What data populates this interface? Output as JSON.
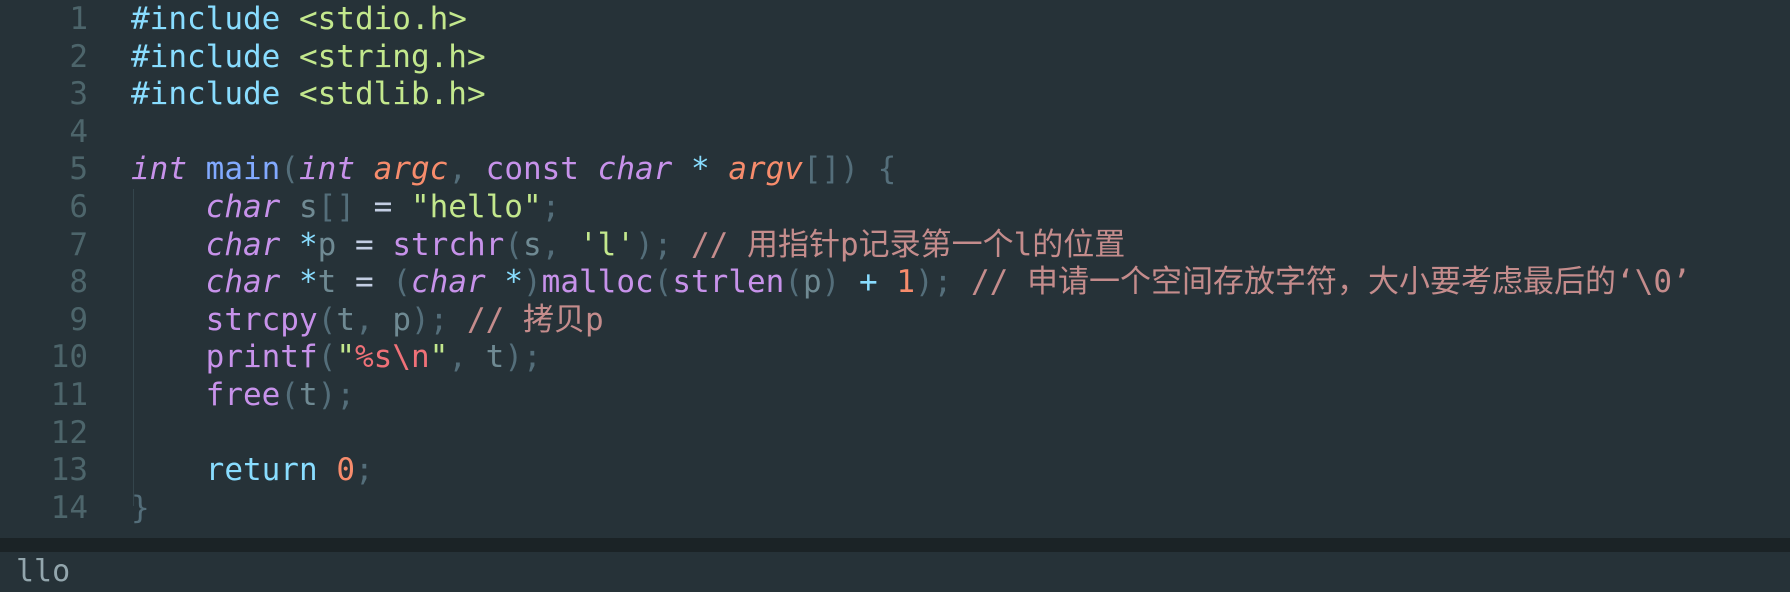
{
  "editor": {
    "line_numbers": [
      "1",
      "2",
      "3",
      "4",
      "5",
      "6",
      "7",
      "8",
      "9",
      "10",
      "11",
      "12",
      "13",
      "14"
    ],
    "lines": [
      [
        {
          "t": "#include",
          "c": "kw"
        },
        {
          "t": " ",
          "c": "plain"
        },
        {
          "t": "<stdio.h>",
          "c": "hdr"
        }
      ],
      [
        {
          "t": "#include",
          "c": "kw"
        },
        {
          "t": " ",
          "c": "plain"
        },
        {
          "t": "<string.h>",
          "c": "hdr"
        }
      ],
      [
        {
          "t": "#include",
          "c": "kw"
        },
        {
          "t": " ",
          "c": "plain"
        },
        {
          "t": "<stdlib.h>",
          "c": "hdr"
        }
      ],
      [],
      [
        {
          "t": "int",
          "c": "typ"
        },
        {
          "t": " ",
          "c": "plain"
        },
        {
          "t": "main",
          "c": "fn"
        },
        {
          "t": "(",
          "c": "pun"
        },
        {
          "t": "int",
          "c": "typ"
        },
        {
          "t": " ",
          "c": "plain"
        },
        {
          "t": "argc",
          "c": "par"
        },
        {
          "t": ", ",
          "c": "pun"
        },
        {
          "t": "const",
          "c": "lib"
        },
        {
          "t": " ",
          "c": "plain"
        },
        {
          "t": "char",
          "c": "typ"
        },
        {
          "t": " ",
          "c": "plain"
        },
        {
          "t": "*",
          "c": "op"
        },
        {
          "t": " ",
          "c": "plain"
        },
        {
          "t": "argv",
          "c": "par"
        },
        {
          "t": "[]) {",
          "c": "pun"
        }
      ],
      [
        {
          "t": "    ",
          "c": "plain"
        },
        {
          "t": "char",
          "c": "typ"
        },
        {
          "t": " ",
          "c": "plain"
        },
        {
          "t": "s",
          "c": "var"
        },
        {
          "t": "[]",
          "c": "pun"
        },
        {
          "t": " = ",
          "c": "plain"
        },
        {
          "t": "\"hello\"",
          "c": "str"
        },
        {
          "t": ";",
          "c": "pun"
        }
      ],
      [
        {
          "t": "    ",
          "c": "plain"
        },
        {
          "t": "char",
          "c": "typ"
        },
        {
          "t": " ",
          "c": "plain"
        },
        {
          "t": "*",
          "c": "op"
        },
        {
          "t": "p",
          "c": "var"
        },
        {
          "t": " = ",
          "c": "plain"
        },
        {
          "t": "strchr",
          "c": "fnp"
        },
        {
          "t": "(",
          "c": "pun"
        },
        {
          "t": "s",
          "c": "var"
        },
        {
          "t": ", ",
          "c": "pun"
        },
        {
          "t": "'l'",
          "c": "str"
        },
        {
          "t": "); ",
          "c": "pun"
        },
        {
          "t": "// 用指针p记录第一个l的位置",
          "c": "cmt"
        }
      ],
      [
        {
          "t": "    ",
          "c": "plain"
        },
        {
          "t": "char",
          "c": "typ"
        },
        {
          "t": " ",
          "c": "plain"
        },
        {
          "t": "*",
          "c": "op"
        },
        {
          "t": "t",
          "c": "var"
        },
        {
          "t": " = ",
          "c": "plain"
        },
        {
          "t": "(",
          "c": "pun"
        },
        {
          "t": "char",
          "c": "typ"
        },
        {
          "t": " ",
          "c": "plain"
        },
        {
          "t": "*",
          "c": "op"
        },
        {
          "t": ")",
          "c": "pun"
        },
        {
          "t": "malloc",
          "c": "fnp"
        },
        {
          "t": "(",
          "c": "pun"
        },
        {
          "t": "strlen",
          "c": "fnp"
        },
        {
          "t": "(",
          "c": "pun"
        },
        {
          "t": "p",
          "c": "var"
        },
        {
          "t": ") ",
          "c": "pun"
        },
        {
          "t": "+",
          "c": "op"
        },
        {
          "t": " ",
          "c": "plain"
        },
        {
          "t": "1",
          "c": "num"
        },
        {
          "t": "); ",
          "c": "pun"
        },
        {
          "t": "// 申请一个空间存放字符，大小要考虑最后的‘\\0’",
          "c": "cmt"
        }
      ],
      [
        {
          "t": "    ",
          "c": "plain"
        },
        {
          "t": "strcpy",
          "c": "fnp"
        },
        {
          "t": "(",
          "c": "pun"
        },
        {
          "t": "t",
          "c": "var"
        },
        {
          "t": ", ",
          "c": "pun"
        },
        {
          "t": "p",
          "c": "var"
        },
        {
          "t": "); ",
          "c": "pun"
        },
        {
          "t": "// 拷贝p",
          "c": "cmt"
        }
      ],
      [
        {
          "t": "    ",
          "c": "plain"
        },
        {
          "t": "printf",
          "c": "fnp"
        },
        {
          "t": "(",
          "c": "pun"
        },
        {
          "t": "\"",
          "c": "str"
        },
        {
          "t": "%s\\n",
          "c": "fmt"
        },
        {
          "t": "\"",
          "c": "str"
        },
        {
          "t": ", ",
          "c": "pun"
        },
        {
          "t": "t",
          "c": "var"
        },
        {
          "t": ");",
          "c": "pun"
        }
      ],
      [
        {
          "t": "    ",
          "c": "plain"
        },
        {
          "t": "free",
          "c": "fnp"
        },
        {
          "t": "(",
          "c": "pun"
        },
        {
          "t": "t",
          "c": "var"
        },
        {
          "t": ");",
          "c": "pun"
        }
      ],
      [],
      [
        {
          "t": "    ",
          "c": "plain"
        },
        {
          "t": "return",
          "c": "kw"
        },
        {
          "t": " ",
          "c": "plain"
        },
        {
          "t": "0",
          "c": "num"
        },
        {
          "t": ";",
          "c": "pun"
        }
      ],
      [
        {
          "t": "}",
          "c": "pun"
        }
      ]
    ]
  },
  "console": {
    "output": "llo"
  },
  "colors": {
    "background": "#263238",
    "gutter": "#4d656b",
    "keyword": "#89ddff",
    "string": "#c3e88d",
    "type": "#c792ea",
    "parameter": "#f78c6c",
    "comment": "#c48c8c",
    "divider": "#1b2326"
  }
}
